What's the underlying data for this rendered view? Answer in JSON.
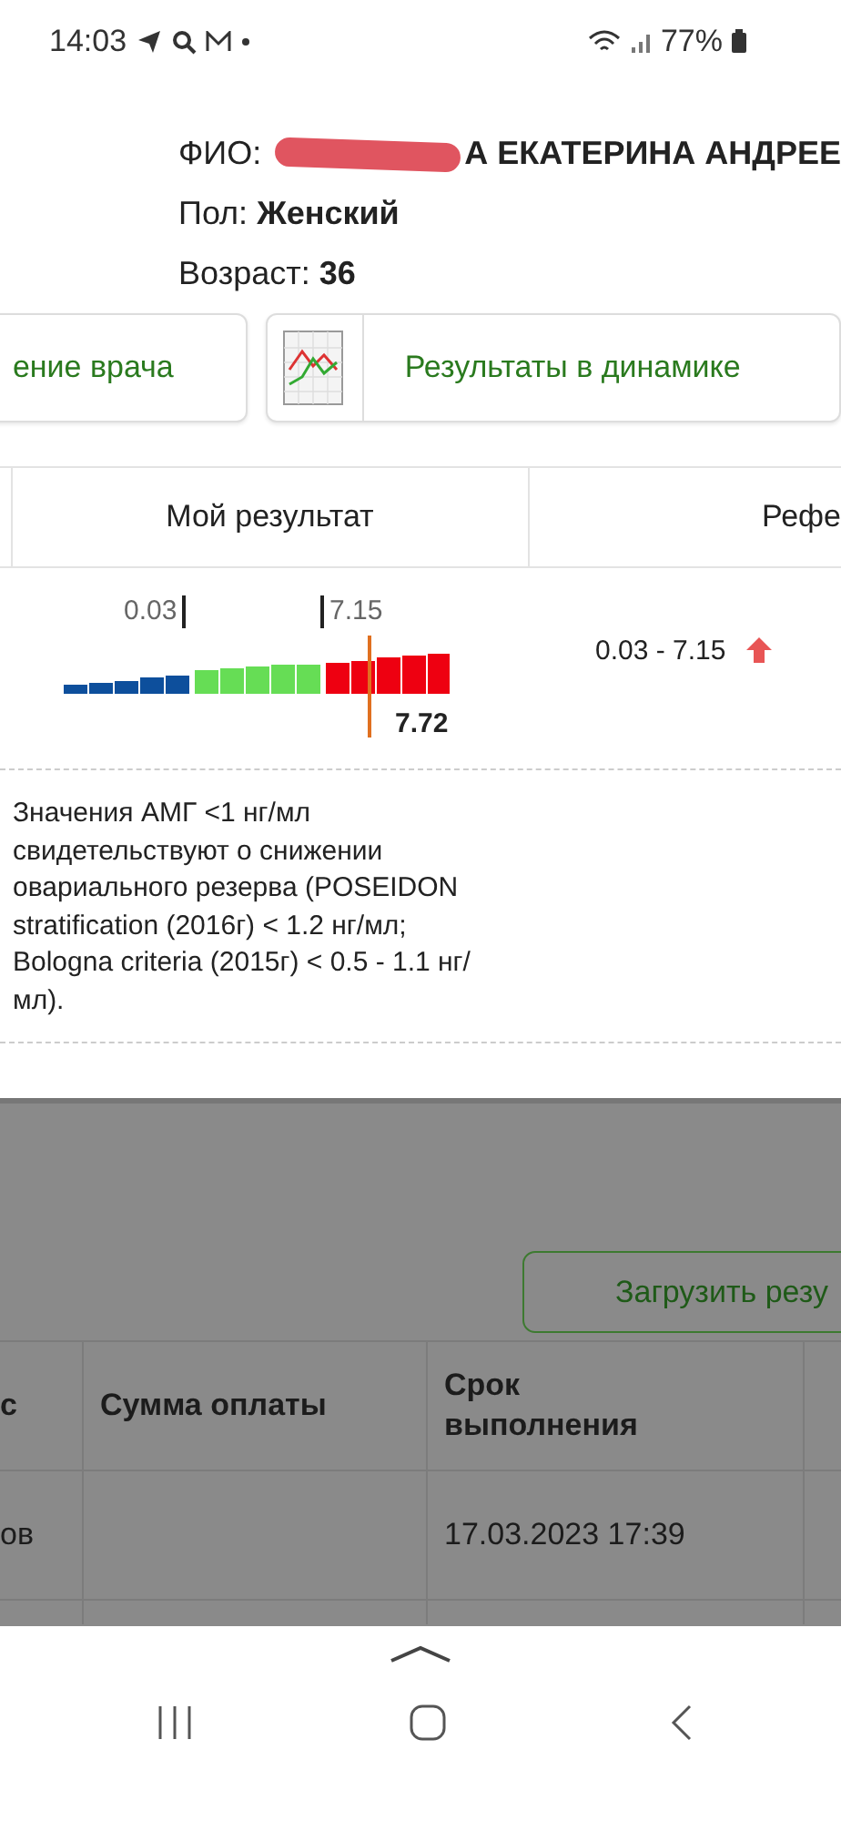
{
  "status_bar": {
    "time": "14:03",
    "battery": "77%"
  },
  "patient": {
    "name_label": "ФИО:",
    "name_value": "А ЕКАТЕРИНА АНДРЕЕ",
    "sex_label": "Пол:",
    "sex_value": "Женский",
    "age_label": "Возраст:",
    "age_value": "36"
  },
  "actions": [
    {
      "label": "ение врача",
      "kind": "plain"
    },
    {
      "label": "Результаты в динамике",
      "kind": "chart"
    }
  ],
  "result_table": {
    "columns": [
      "Мой результат",
      "Рефе"
    ],
    "row": {
      "low_label": "0.03",
      "high_label": "7.15",
      "value_label": "7.72",
      "reference": "0.03 - 7.15",
      "above_range": true
    }
  },
  "note": "Значения АМГ <1 нг/мл свидетельствуют о снижении овариального резерва (POSEIDON stratification (2016г) < 1.2 нг/мл; Bologna criteria (2015г) < 0.5 - 1.1 нг/мл).",
  "background_page": {
    "button": "Загрузить резу",
    "columns": [
      "с",
      "Сумма оплаты",
      "Срок выполнения"
    ],
    "rows": [
      [
        "ов",
        "",
        "17.03.2023 17:39"
      ]
    ]
  }
}
